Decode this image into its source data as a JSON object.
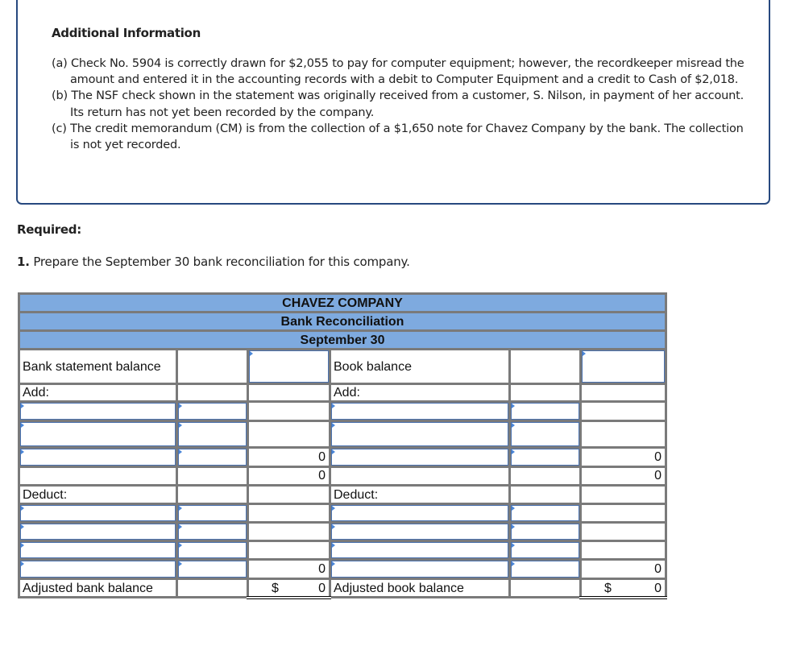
{
  "additional_information": {
    "title": "Additional Information",
    "items": [
      {
        "label": "(a)",
        "text": "(a) Check No. 5904 is correctly drawn for $2,055 to pay for computer equipment; however, the recordkeeper misread the amount and entered it in the accounting records with a debit to Computer Equipment and a credit to Cash of $2,018."
      },
      {
        "label": "(b)",
        "text": "(b) The NSF check shown in the statement was originally received from a customer, S. Nilson, in payment of her account. Its return has not yet been recorded by the company."
      },
      {
        "label": "(c)",
        "text": "(c) The credit memorandum (CM) is from the collection of a $1,650 note for Chavez Company by the bank. The collection is not yet recorded."
      }
    ]
  },
  "required": {
    "label": "Required:",
    "task_number": "1.",
    "task_text": " Prepare the September 30 bank reconciliation for this company."
  },
  "reconciliation": {
    "header": {
      "company": "CHAVEZ COMPANY",
      "title": "Bank Reconciliation",
      "date": "September 30"
    },
    "bank_side": {
      "balance_label": "Bank statement balance",
      "balance_value": "",
      "add_label": "Add:",
      "add_rows": [
        {
          "description": "",
          "amount": ""
        },
        {
          "description": "",
          "amount": ""
        },
        {
          "description": "",
          "amount": ""
        }
      ],
      "add_subtotal": "0",
      "add_total": "0",
      "deduct_label": "Deduct:",
      "deduct_rows": [
        {
          "description": "",
          "amount": ""
        },
        {
          "description": "",
          "amount": ""
        },
        {
          "description": "",
          "amount": ""
        },
        {
          "description": "",
          "amount": ""
        }
      ],
      "deduct_subtotal": "0",
      "adjusted_label": "Adjusted bank balance",
      "adjusted_currency": "$",
      "adjusted_value": "0"
    },
    "book_side": {
      "balance_label": "Book balance",
      "balance_value": "",
      "add_label": "Add:",
      "add_rows": [
        {
          "description": "",
          "amount": ""
        },
        {
          "description": "",
          "amount": ""
        },
        {
          "description": "",
          "amount": ""
        }
      ],
      "add_subtotal": "0",
      "add_total": "0",
      "deduct_label": "Deduct:",
      "deduct_rows": [
        {
          "description": "",
          "amount": ""
        },
        {
          "description": "",
          "amount": ""
        },
        {
          "description": "",
          "amount": ""
        },
        {
          "description": "",
          "amount": ""
        }
      ],
      "deduct_subtotal": "0",
      "adjusted_label": "Adjusted book balance",
      "adjusted_currency": "$",
      "adjusted_value": "0"
    }
  },
  "colors": {
    "header_bg": "#7eaadf",
    "box_border": "#27497f",
    "input_border": "#4a72b0",
    "grid_line": "#7a7a7a"
  }
}
